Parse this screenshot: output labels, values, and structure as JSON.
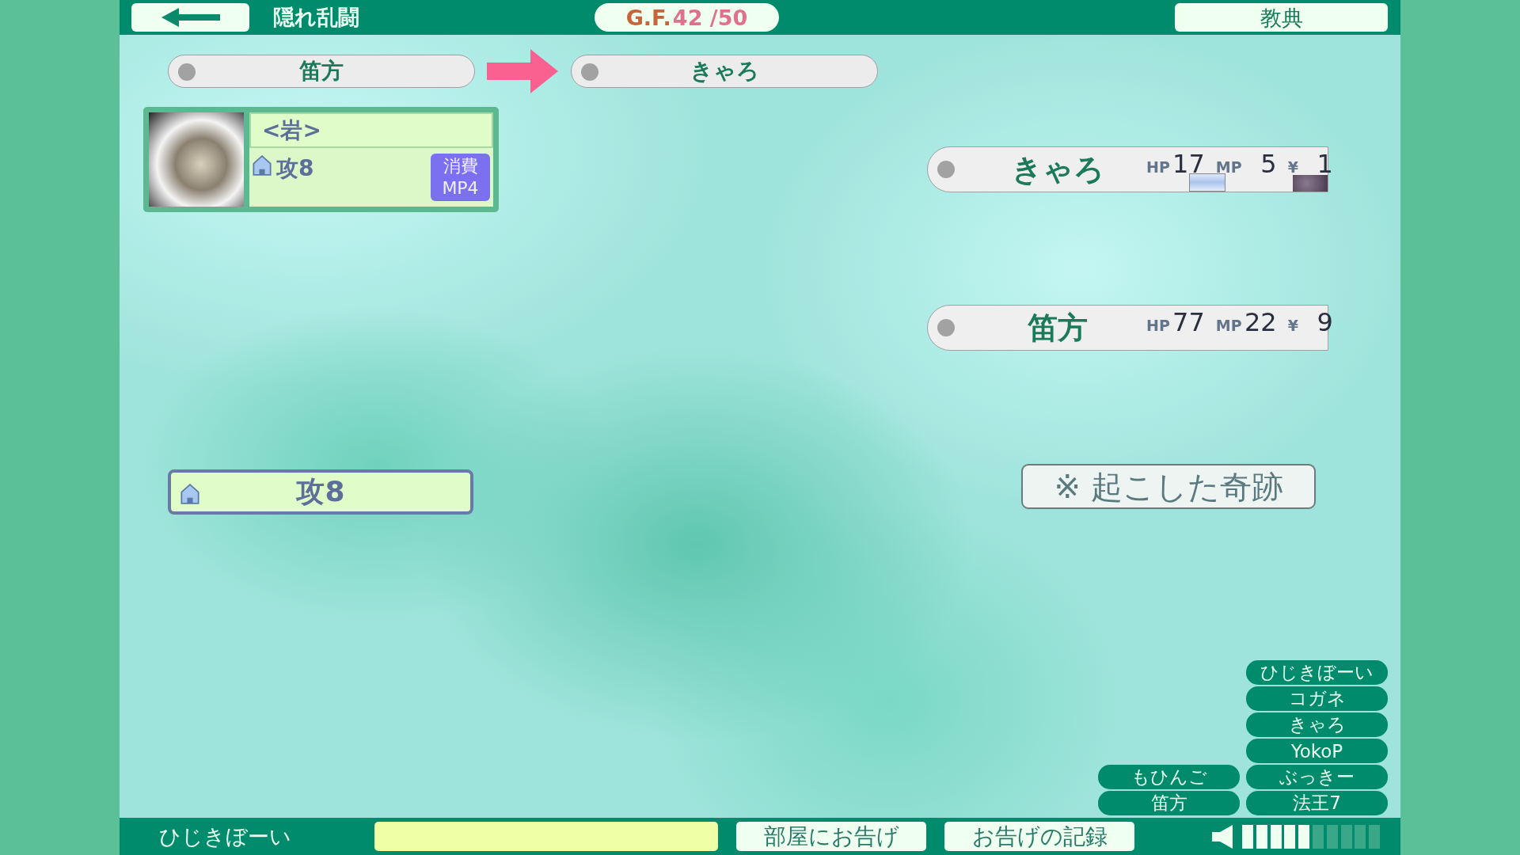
{
  "top_bar": {
    "title": "隠れ乱闘",
    "gf_label": "G.F.",
    "gf_value": "42 /50",
    "codex_button": "教典"
  },
  "turn": {
    "from": "笛方",
    "to": "きゃろ"
  },
  "card": {
    "name": "<岩>",
    "effect": "攻8",
    "cost_lines": [
      "消費",
      "MP4"
    ]
  },
  "selected_skill": "攻8",
  "players": [
    {
      "name": "きゃろ",
      "hp_label": "HP",
      "hp": "17",
      "mp_label": "MP",
      "mp": "5",
      "money_label": "¥",
      "money": "1",
      "mp_effect": {
        "kind": "mist"
      },
      "money_effect": {
        "kind": "shadow"
      }
    },
    {
      "name": "笛方",
      "hp_label": "HP",
      "hp": "77",
      "mp_label": "MP",
      "mp": "22",
      "money_label": "¥",
      "money": "9"
    }
  ],
  "miracles_button": "※ 起こした奇跡",
  "name_list": {
    "columns": [
      [
        "もひんご",
        "笛方"
      ],
      [
        "ひじきぼーい",
        "コガネ",
        "きゃろ",
        "YokoP",
        "ぶっきー",
        "法王7"
      ]
    ]
  },
  "bottom_bar": {
    "user": "ひじきぼーい",
    "announce_button": "部屋にお告げ",
    "log_button": "お告げの記録",
    "volume": {
      "level": 0.5
    }
  }
}
